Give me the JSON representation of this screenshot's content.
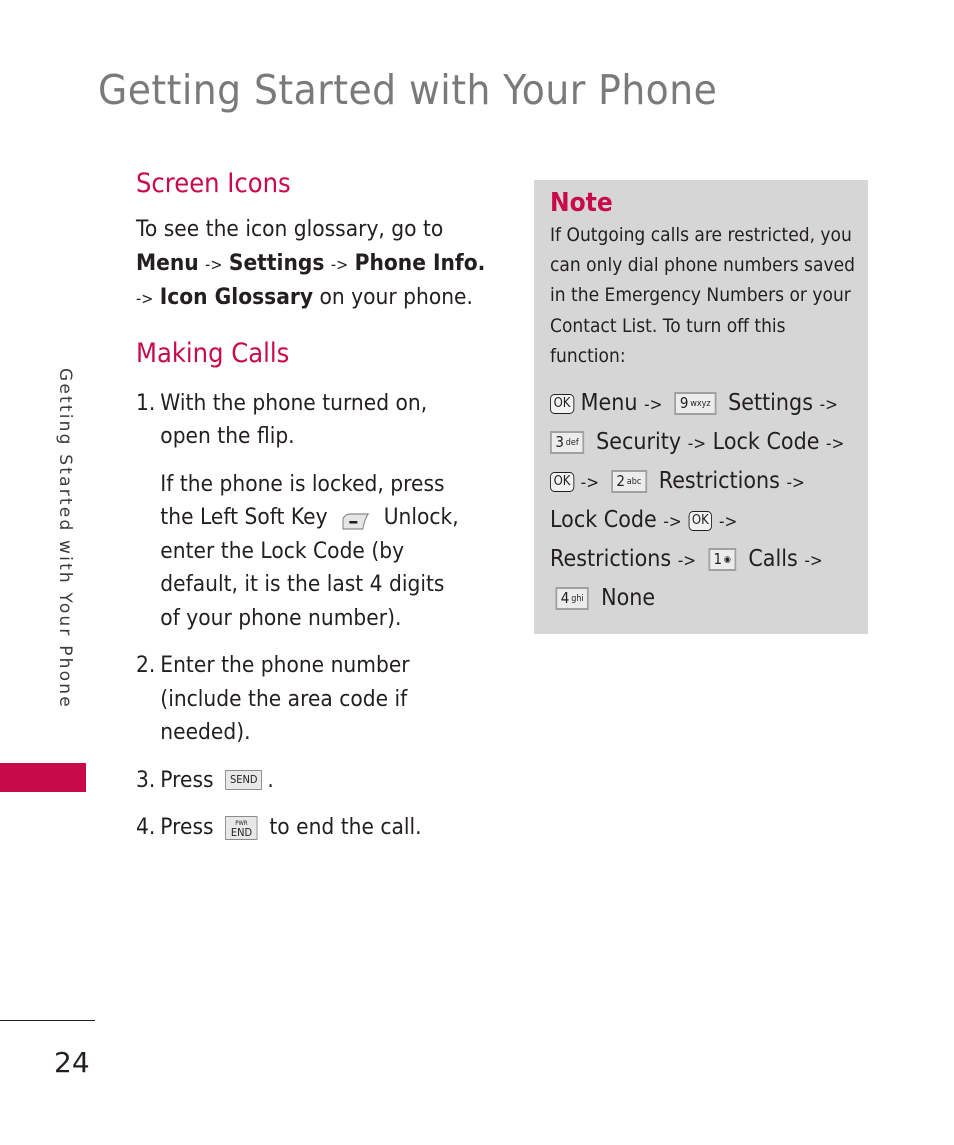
{
  "page": {
    "title": "Getting Started with Your Phone",
    "side_tab": "Getting Started with Your Phone",
    "page_number": "24",
    "accent_color": "#c8094a",
    "note_bg_color": "#d6d6d6"
  },
  "screen_icons": {
    "heading": "Screen Icons",
    "line1": "To see the icon glossary, go to",
    "menu": "Menu",
    "arrow": "->",
    "settings": "Settings",
    "phone_info": "Phone Info.",
    "icon_glossary": "Icon Glossary",
    "suffix": "on your phone."
  },
  "making_calls": {
    "heading": "Making Calls",
    "steps": [
      {
        "num": "1.",
        "line1": "With the phone turned on,",
        "line2": "open the flip.",
        "sub_line1": "If the phone is locked, press",
        "sub_line2a": "the Left Soft Key",
        "sub_line2b": "Unlock,",
        "sub_line3": "enter the Lock Code (by",
        "sub_line4": "default, it is the last 4 digits",
        "sub_line5": "of your phone number).",
        "icon": "left-soft-key-icon"
      },
      {
        "num": "2.",
        "line1": "Enter the phone number",
        "line2": "(include the area code if",
        "line3": "needed)."
      },
      {
        "num": "3.",
        "prefix": "Press",
        "key": "SEND",
        "suffix": "."
      },
      {
        "num": "4.",
        "prefix": "Press",
        "key_top": "PWR",
        "key": "END",
        "suffix": "to end the call."
      }
    ]
  },
  "note": {
    "title": "Note",
    "lines": [
      "If Outgoing calls are restricted, you",
      "can only dial phone numbers saved",
      "in the Emergency Numbers or your",
      "Contact List. To turn off this",
      "function:"
    ],
    "path": {
      "ok": "OK",
      "menu": "Menu",
      "arrow": "->",
      "key9": "9",
      "key9_letters": "wxyz",
      "settings": "Settings",
      "key3": "3",
      "key3_letters": "def",
      "security": "Security",
      "lock_code": "Lock Code",
      "key2": "2",
      "key2_letters": "abc",
      "restrictions": "Restrictions",
      "key1": "1",
      "key1_letters": "voicemail",
      "calls": "Calls",
      "key4": "4",
      "key4_letters": "ghi",
      "none": "None"
    }
  }
}
